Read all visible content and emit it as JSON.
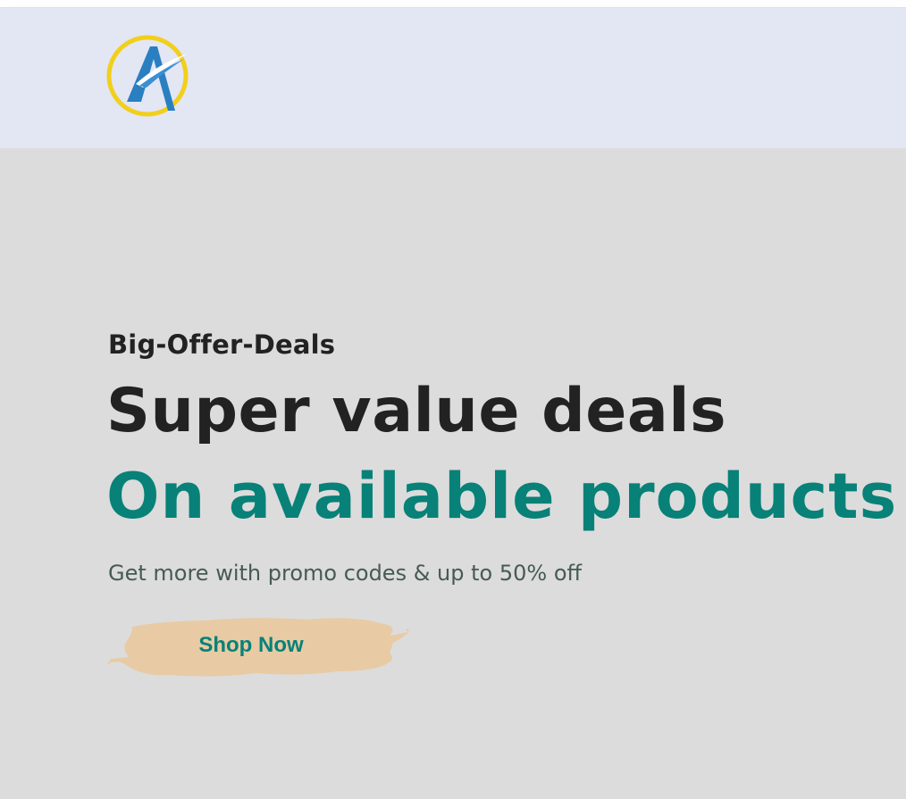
{
  "header": {
    "logo_icon": "compass-a-logo",
    "background_color": "#e3e6f3"
  },
  "hero": {
    "eyebrow": "Big-Offer-Deals",
    "headline": "Super value deals",
    "headline_accent": "On available products",
    "subtext": "Get more with promo codes & up to 50% off",
    "cta_label": "Shop Now",
    "accent_color": "#088178",
    "cta_background_color": "#e8cba4",
    "background_color": "#dcdcdc"
  }
}
